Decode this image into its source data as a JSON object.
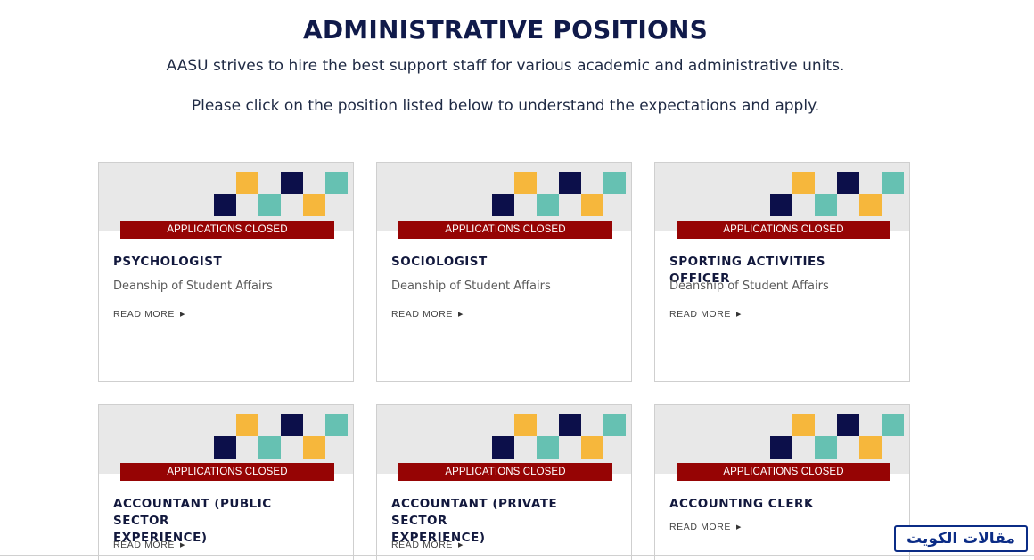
{
  "page": {
    "title": "ADMINISTRATIVE POSITIONS",
    "intro_line1": "AASU strives to hire the best support staff for various academic and administrative units.",
    "intro_line2": "Please click on the position listed below to understand the expectations and apply."
  },
  "colors": {
    "navy": "#0c0f4a",
    "gold": "#f6b73c",
    "teal": "#66c1b2",
    "status_red": "#960404",
    "banner_gray": "#e8e8e8"
  },
  "cards": [
    {
      "status": "APPLICATIONS CLOSED",
      "title_line1": "PSYCHOLOGIST",
      "title_line2": "",
      "department": "Deanship of Student Affairs",
      "read_more": "READ MORE"
    },
    {
      "status": "APPLICATIONS CLOSED",
      "title_line1": "SOCIOLOGIST",
      "title_line2": "",
      "department": "Deanship of Student Affairs",
      "read_more": "READ MORE"
    },
    {
      "status": "APPLICATIONS CLOSED",
      "title_line1": "SPORTING ACTIVITIES OFFICER",
      "title_line2": "",
      "department": "Deanship of Student Affairs",
      "read_more": "READ MORE"
    },
    {
      "status": "APPLICATIONS CLOSED",
      "title_line1": "ACCOUNTANT (PUBLIC SECTOR",
      "title_line2": "EXPERIENCE)",
      "department": "",
      "read_more": "READ MORE"
    },
    {
      "status": "APPLICATIONS CLOSED",
      "title_line1": "ACCOUNTANT (PRIVATE SECTOR",
      "title_line2": "EXPERIENCE)",
      "department": "",
      "read_more": "READ MORE"
    },
    {
      "status": "APPLICATIONS CLOSED",
      "title_line1": "ACCOUNTING CLERK",
      "title_line2": "",
      "department": "",
      "read_more": "READ MORE"
    }
  ],
  "watermark": {
    "text": "مقالات الكويت"
  }
}
